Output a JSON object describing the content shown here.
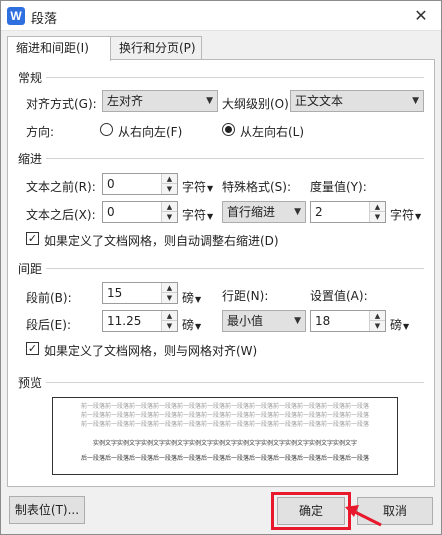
{
  "window": {
    "title": "段落",
    "app_icon_letter": "W",
    "close_glyph": "✕"
  },
  "tabs": [
    {
      "label": "缩进和间距(I)"
    },
    {
      "label": "换行和分页(P)"
    }
  ],
  "general": {
    "heading": "常规",
    "align_label": "对齐方式(G):",
    "align_value": "左对齐",
    "outline_label": "大纲级别(O):",
    "outline_value": "正文文本",
    "direction_label": "方向:",
    "rtl_label": "从右向左(F)",
    "ltr_label": "从左向右(L)"
  },
  "indent": {
    "heading": "缩进",
    "before_label": "文本之前(R):",
    "before_value": "0",
    "before_unit": "字符",
    "after_label": "文本之后(X):",
    "after_value": "0",
    "after_unit": "字符",
    "special_label": "特殊格式(S):",
    "special_value": "首行缩进",
    "measure_label": "度量值(Y):",
    "measure_value": "2",
    "measure_unit": "字符",
    "auto_adjust_label": "如果定义了文档网格，则自动调整右缩进(D)"
  },
  "spacing": {
    "heading": "间距",
    "before_label": "段前(B):",
    "before_value": "15",
    "before_unit": "磅",
    "after_label": "段后(E):",
    "after_value": "11.25",
    "after_unit": "磅",
    "line_label": "行距(N):",
    "line_value": "最小值",
    "setting_label": "设置值(A):",
    "setting_value": "18",
    "setting_unit": "磅",
    "grid_align_label": "如果定义了文档网格，则与网格对齐(W)"
  },
  "preview": {
    "heading": "预览",
    "prev_line": "前一段落前一段落前一段落前一段落前一段落前一段落前一段落前一段落前一段落前一段落前一段落前一段落",
    "sample_line": "实例文字实例文字实例文字实例文字实例文字实例文字实例文字实例文字实例文字实例文字实例文字",
    "next_line": "后一段落后一段落后一段落后一段落后一段落后一段落后一段落后一段落后一段落后一段落后一段落后一段落"
  },
  "buttons": {
    "tabs_label": "制表位(T)...",
    "ok_label": "确定",
    "cancel_label": "取消"
  },
  "colors": {
    "highlight": "#e8192c",
    "app_icon": "#2f6fe0"
  }
}
